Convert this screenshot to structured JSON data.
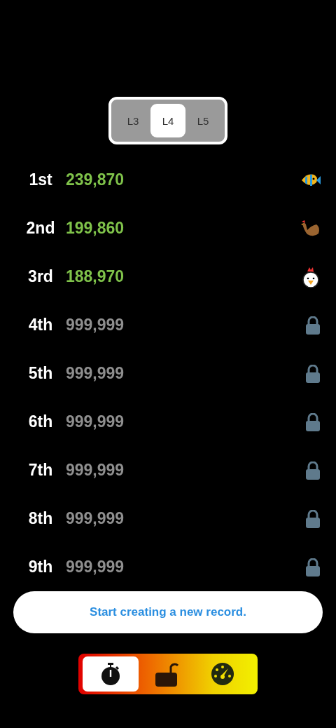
{
  "levels": [
    {
      "label": "L3",
      "selected": false
    },
    {
      "label": "L4",
      "selected": true
    },
    {
      "label": "L5",
      "selected": false
    }
  ],
  "records": [
    {
      "rank": "1st",
      "score": "239,870",
      "kind": "achieved"
    },
    {
      "rank": "2nd",
      "score": "199,860",
      "kind": "achieved"
    },
    {
      "rank": "3rd",
      "score": "188,970",
      "kind": "achieved"
    },
    {
      "rank": "4th",
      "score": "999,999",
      "kind": "locked"
    },
    {
      "rank": "5th",
      "score": "999,999",
      "kind": "locked"
    },
    {
      "rank": "6th",
      "score": "999,999",
      "kind": "locked"
    },
    {
      "rank": "7th",
      "score": "999,999",
      "kind": "locked"
    },
    {
      "rank": "8th",
      "score": "999,999",
      "kind": "locked"
    },
    {
      "rank": "9th",
      "score": "999,999",
      "kind": "locked"
    }
  ],
  "start_button": "Start creating a new record.",
  "modes": [
    {
      "selected": true
    },
    {
      "selected": false
    },
    {
      "selected": false
    }
  ]
}
